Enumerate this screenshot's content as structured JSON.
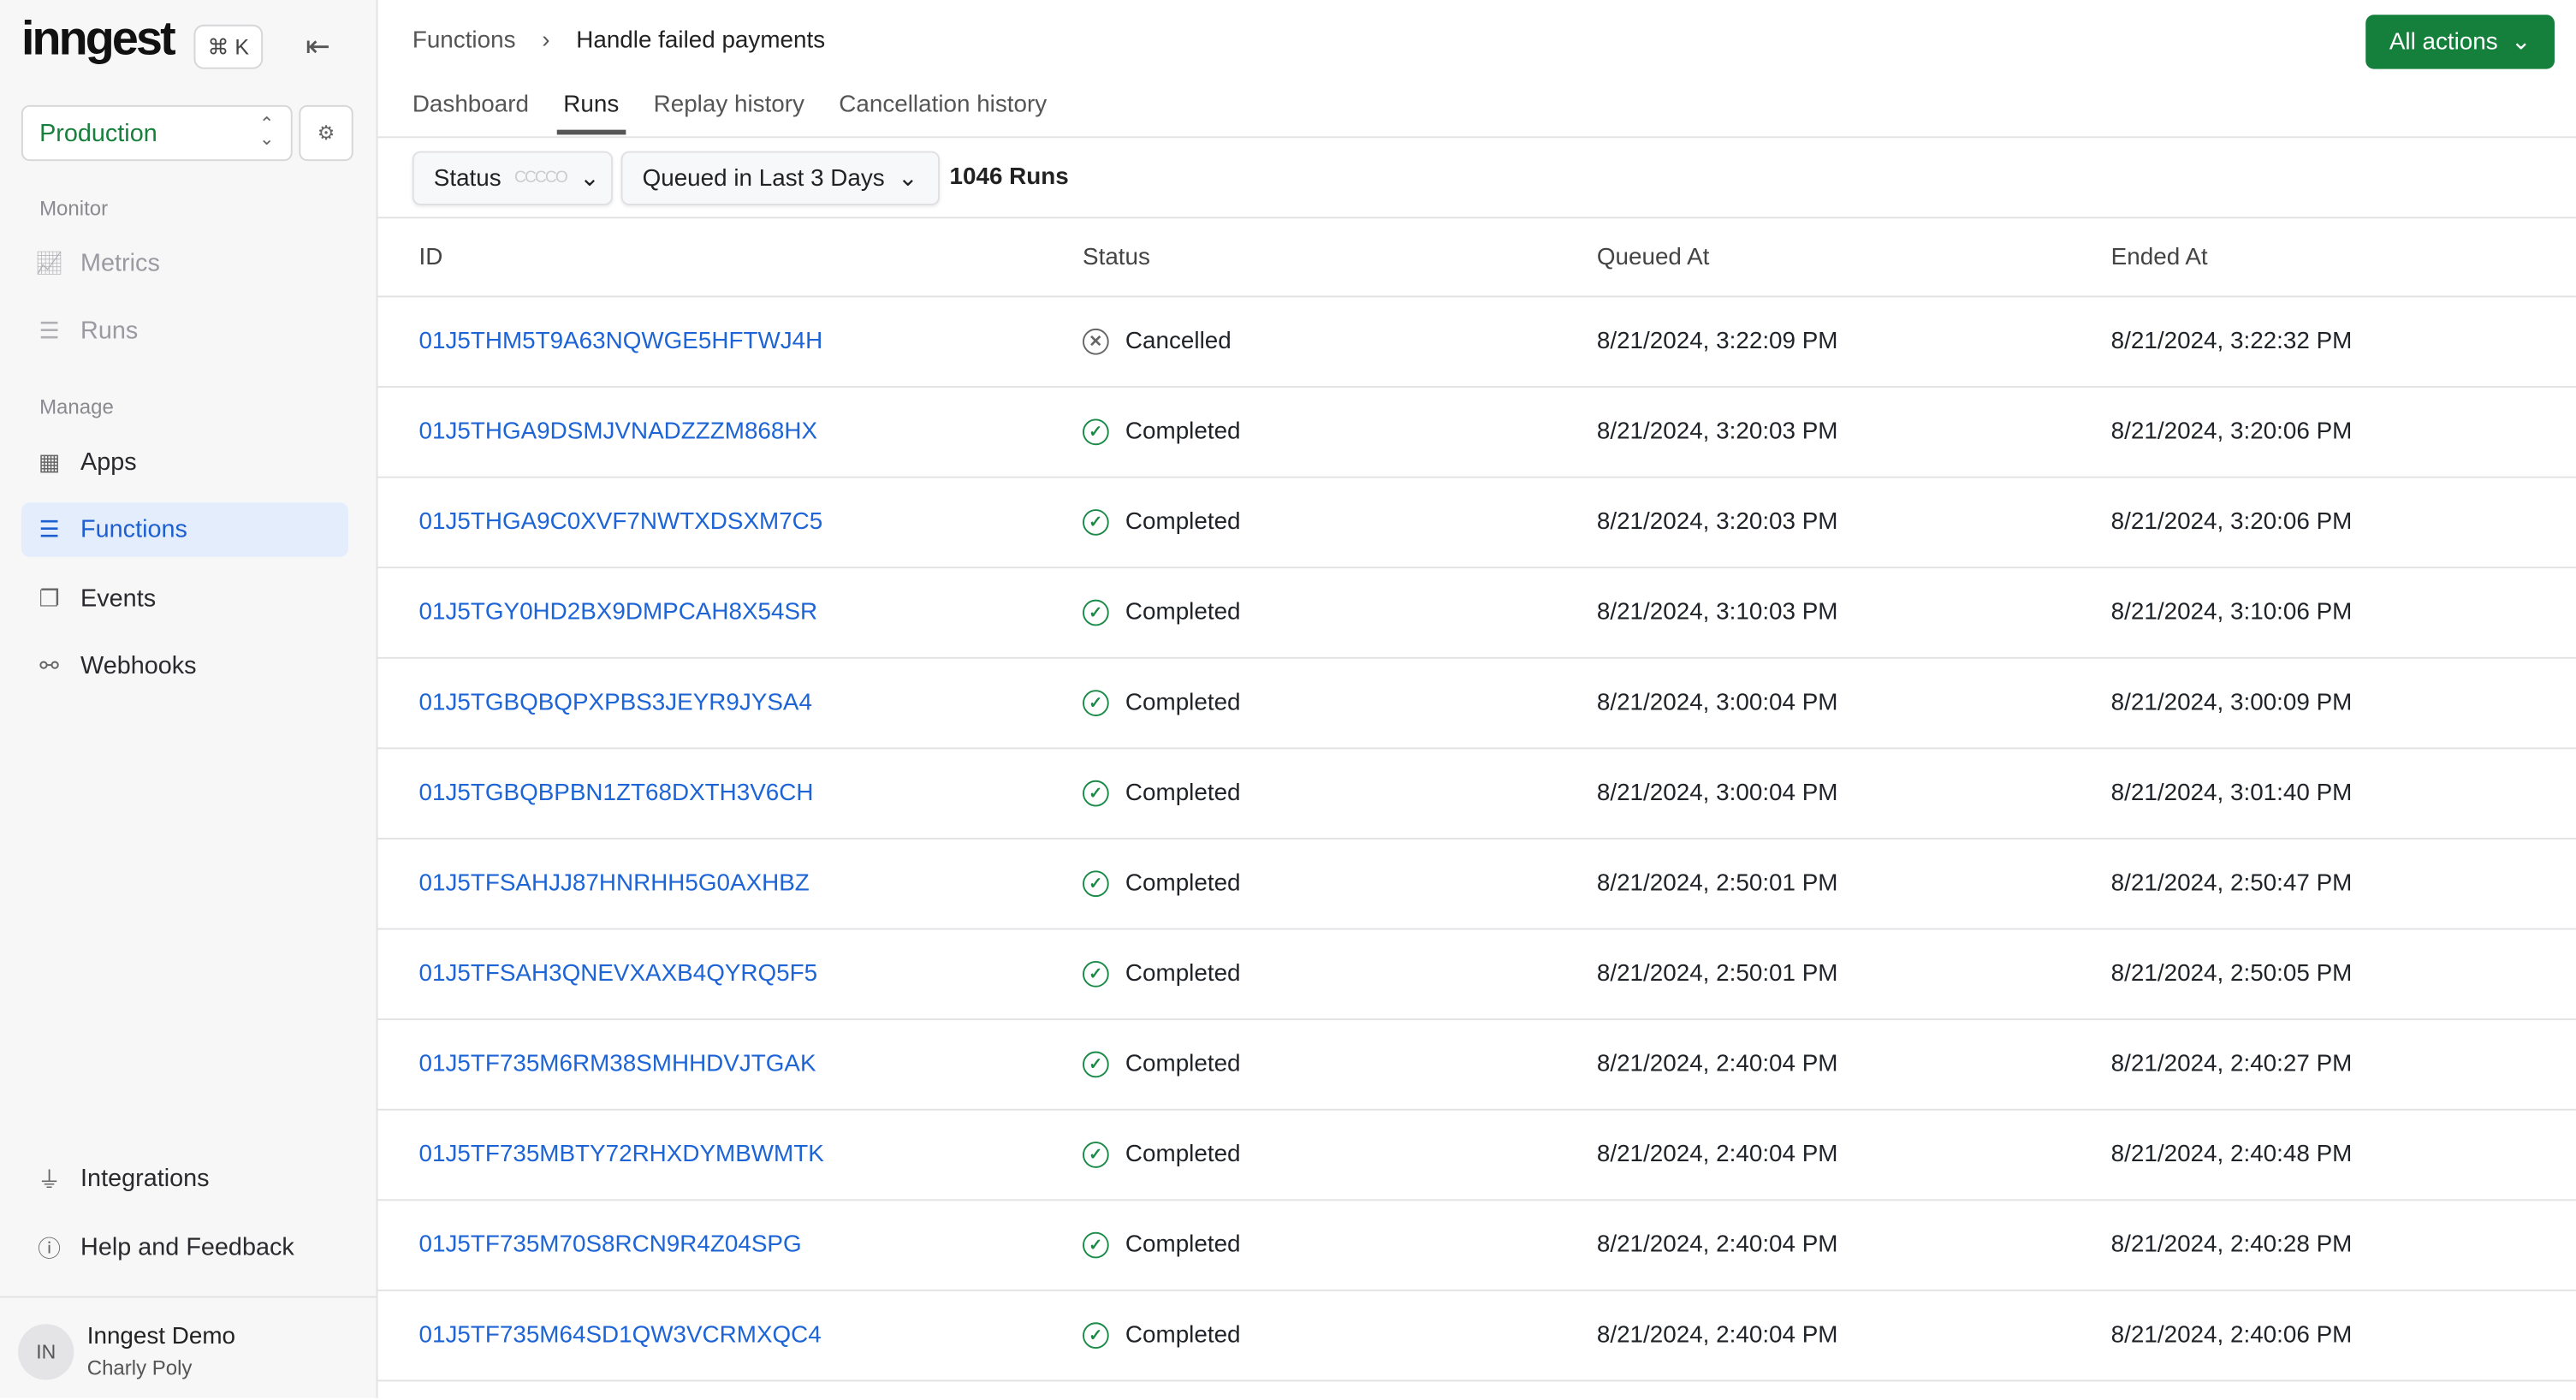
{
  "sidebar": {
    "logo": "inngest",
    "shortcut": "⌘ K",
    "environment": "Production",
    "sections": {
      "monitor": "Monitor",
      "manage": "Manage"
    },
    "items": [
      {
        "label": "Metrics",
        "icon": "chart-icon"
      },
      {
        "label": "Runs",
        "icon": "list-icon"
      },
      {
        "label": "Apps",
        "icon": "apps-icon"
      },
      {
        "label": "Functions",
        "icon": "functions-icon"
      },
      {
        "label": "Events",
        "icon": "events-icon"
      },
      {
        "label": "Webhooks",
        "icon": "webhooks-icon"
      }
    ],
    "bottom": [
      {
        "label": "Integrations"
      },
      {
        "label": "Help and Feedback"
      }
    ],
    "user": {
      "initials": "IN",
      "name": "Inngest Demo",
      "org": "Charly Poly"
    }
  },
  "header": {
    "breadcrumb": [
      "Functions",
      "Handle failed payments"
    ],
    "all_actions": "All actions",
    "tabs": [
      "Dashboard",
      "Runs",
      "Replay history",
      "Cancellation history"
    ],
    "active_tab": "Runs"
  },
  "filters": {
    "status": "Status",
    "status_dots": "CCCCO",
    "time": "Queued in Last 3 Days",
    "count": "1046 Runs"
  },
  "table": {
    "columns": [
      "ID",
      "Status",
      "Queued At",
      "Ended At"
    ],
    "rows": [
      {
        "id": "01J5THM5T9A63NQWGE5HFTWJ4H",
        "status": "Cancelled",
        "queued": "8/21/2024, 3:22:09 PM",
        "ended": "8/21/2024, 3:22:32 PM"
      },
      {
        "id": "01J5THGA9DSMJVNADZZZM868HX",
        "status": "Completed",
        "queued": "8/21/2024, 3:20:03 PM",
        "ended": "8/21/2024, 3:20:06 PM"
      },
      {
        "id": "01J5THGA9C0XVF7NWTXDSXM7C5",
        "status": "Completed",
        "queued": "8/21/2024, 3:20:03 PM",
        "ended": "8/21/2024, 3:20:06 PM"
      },
      {
        "id": "01J5TGY0HD2BX9DMPCAH8X54SR",
        "status": "Completed",
        "queued": "8/21/2024, 3:10:03 PM",
        "ended": "8/21/2024, 3:10:06 PM"
      },
      {
        "id": "01J5TGBQBQPXPBS3JEYR9JYSA4",
        "status": "Completed",
        "queued": "8/21/2024, 3:00:04 PM",
        "ended": "8/21/2024, 3:00:09 PM"
      },
      {
        "id": "01J5TGBQBPBN1ZT68DXTH3V6CH",
        "status": "Completed",
        "queued": "8/21/2024, 3:00:04 PM",
        "ended": "8/21/2024, 3:01:40 PM"
      },
      {
        "id": "01J5TFSAHJJ87HNRHH5G0AXHBZ",
        "status": "Completed",
        "queued": "8/21/2024, 2:50:01 PM",
        "ended": "8/21/2024, 2:50:47 PM"
      },
      {
        "id": "01J5TFSAH3QNEVXAXB4QYRQ5F5",
        "status": "Completed",
        "queued": "8/21/2024, 2:50:01 PM",
        "ended": "8/21/2024, 2:50:05 PM"
      },
      {
        "id": "01J5TF735M6RM38SMHHDVJTGAK",
        "status": "Completed",
        "queued": "8/21/2024, 2:40:04 PM",
        "ended": "8/21/2024, 2:40:27 PM"
      },
      {
        "id": "01J5TF735MBTY72RHXDYMBWMTK",
        "status": "Completed",
        "queued": "8/21/2024, 2:40:04 PM",
        "ended": "8/21/2024, 2:40:48 PM"
      },
      {
        "id": "01J5TF735M70S8RCN9R4Z04SPG",
        "status": "Completed",
        "queued": "8/21/2024, 2:40:04 PM",
        "ended": "8/21/2024, 2:40:28 PM"
      },
      {
        "id": "01J5TF735M64SD1QW3VCRMXQC4",
        "status": "Completed",
        "queued": "8/21/2024, 2:40:04 PM",
        "ended": "8/21/2024, 2:40:06 PM"
      }
    ]
  },
  "colors": {
    "accent": "#157f3c",
    "link": "#1d64d6",
    "active_nav_bg": "#e3edfb"
  }
}
